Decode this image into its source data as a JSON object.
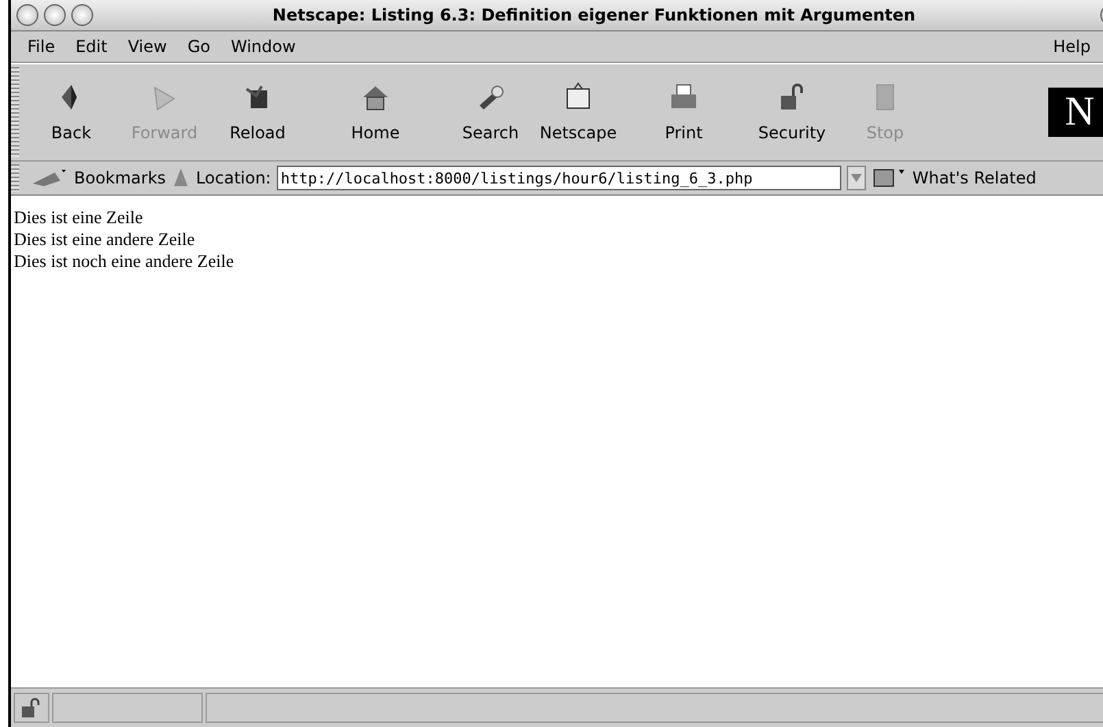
{
  "window": {
    "title": "Netscape: Listing 6.3: Definition eigener Funktionen mit Argumenten"
  },
  "menu": [
    "File",
    "Edit",
    "View",
    "Go",
    "Window"
  ],
  "help_menu": "Help",
  "toolbar": [
    {
      "label": "Back",
      "kind": "back",
      "disabled": false
    },
    {
      "label": "Forward",
      "kind": "forward",
      "disabled": true
    },
    {
      "label": "Reload",
      "kind": "reload",
      "disabled": false
    },
    {
      "label": "Home",
      "kind": "home",
      "disabled": false
    },
    {
      "label": "Search",
      "kind": "search",
      "disabled": false
    },
    {
      "label": "Netscape",
      "kind": "my",
      "disabled": false
    },
    {
      "label": "Print",
      "kind": "print",
      "disabled": false
    },
    {
      "label": "Security",
      "kind": "security",
      "disabled": false
    },
    {
      "label": "Stop",
      "kind": "stop",
      "disabled": true
    }
  ],
  "logo": "N",
  "location_bar": {
    "bookmarks": "Bookmarks",
    "location_label": "Location:",
    "url": "http://localhost:8000/listings/hour6/listing_6_3.php",
    "related": "What's Related"
  },
  "content": [
    "Dies ist eine Zeile",
    "Dies ist eine andere Zeile",
    "Dies ist noch eine andere Zeile"
  ]
}
